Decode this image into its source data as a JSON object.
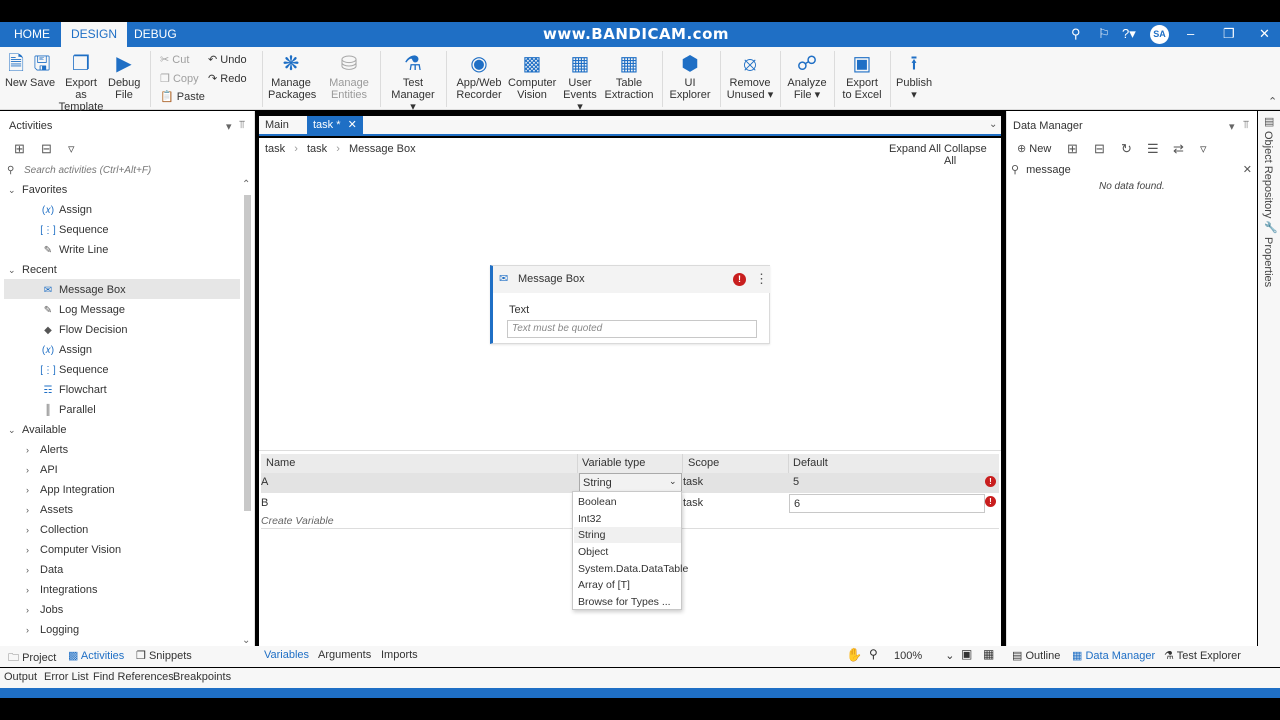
{
  "top_tabs": [
    "HOME",
    "DESIGN",
    "DEBUG"
  ],
  "watermark": "www.BANDICAM.com",
  "user_initials": "SA",
  "ribbon": {
    "new": "New",
    "save": "Save",
    "export_template": [
      "Export as",
      "Template"
    ],
    "debug_file": [
      "Debug",
      "File"
    ],
    "cut": "Cut",
    "copy": "Copy",
    "paste": "Paste",
    "undo": "Undo",
    "redo": "Redo",
    "manage_packages": [
      "Manage",
      "Packages"
    ],
    "manage_entities": [
      "Manage",
      "Entities"
    ],
    "test_manager": [
      "Test",
      "Manager"
    ],
    "app_web_recorder": [
      "App/Web",
      "Recorder"
    ],
    "computer_vision": [
      "Computer",
      "Vision"
    ],
    "user_events": [
      "User",
      "Events"
    ],
    "table_extraction": [
      "Table",
      "Extraction"
    ],
    "ui_explorer": [
      "UI",
      "Explorer"
    ],
    "remove_unused": [
      "Remove",
      "Unused"
    ],
    "analyze_file": [
      "Analyze",
      "File"
    ],
    "export_excel": [
      "Export",
      "to Excel"
    ],
    "publish": "Publish"
  },
  "activities": {
    "title": "Activities",
    "search_placeholder": "Search activities (Ctrl+Alt+F)",
    "favorites_label": "Favorites",
    "favorites": [
      "Assign",
      "Sequence",
      "Write Line"
    ],
    "recent_label": "Recent",
    "recent": [
      "Message Box",
      "Log Message",
      "Flow Decision",
      "Assign",
      "Sequence",
      "Flowchart",
      "Parallel"
    ],
    "available_label": "Available",
    "available": [
      "Alerts",
      "API",
      "App Integration",
      "Assets",
      "Collection",
      "Computer Vision",
      "Data",
      "Integrations",
      "Jobs",
      "Logging"
    ]
  },
  "doc_tabs": [
    "Main",
    "task *"
  ],
  "breadcrumb": [
    "task",
    "task",
    "Message Box"
  ],
  "expand_all": "Expand All",
  "collapse_all": "Collapse All",
  "message_box": {
    "title": "Message Box",
    "text_label": "Text",
    "text_placeholder": "Text must be quoted"
  },
  "variables": {
    "columns": [
      "Name",
      "Variable type",
      "Scope",
      "Default"
    ],
    "rows": [
      {
        "name": "A",
        "type": "String",
        "scope": "task",
        "default": "5"
      },
      {
        "name": "B",
        "type": "",
        "scope": "task",
        "default": "6"
      }
    ],
    "create_variable": "Create Variable"
  },
  "type_dropdown": [
    "Boolean",
    "Int32",
    "String",
    "Object",
    "System.Data.DataTable",
    "Array of [T]",
    "Browse for Types ..."
  ],
  "bottom_tabs": [
    "Variables",
    "Arguments",
    "Imports"
  ],
  "zoom": "100%",
  "data_manager": {
    "title": "Data Manager",
    "new_label": "New",
    "search_value": "message",
    "empty": "No data found."
  },
  "side_tabs": [
    "Object Repository",
    "Properties"
  ],
  "footer_left_tabs": [
    "Project",
    "Activities",
    "Snippets"
  ],
  "footer_right_tabs": [
    "Outline",
    "Data Manager",
    "Test Explorer"
  ],
  "output_tabs": [
    "Output",
    "Error List",
    "Find References",
    "Breakpoints"
  ]
}
